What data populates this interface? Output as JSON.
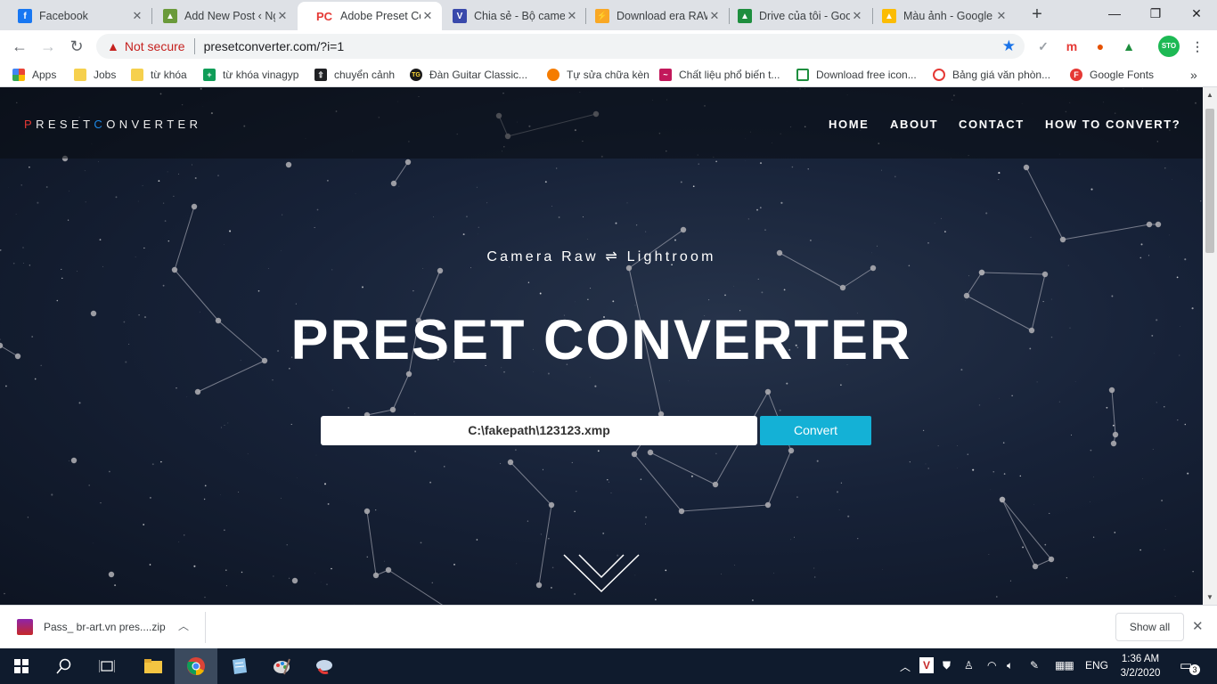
{
  "tabs": [
    {
      "title": "Facebook",
      "favicon_color": "#1877f2",
      "favicon_glyph": "f",
      "active": false
    },
    {
      "title": "Add New Post ‹ Ng",
      "favicon_color": "#6a9a3a",
      "favicon_glyph": "▲",
      "active": false
    },
    {
      "title": "Adobe Preset Conv",
      "favicon_color": "#e53935",
      "favicon_glyph": "PC",
      "active": true
    },
    {
      "title": "Chia sẻ - Bộ came",
      "favicon_color": "#3949ab",
      "favicon_glyph": "V",
      "active": false
    },
    {
      "title": "Download era RAW",
      "favicon_color": "#f9a825",
      "favicon_glyph": "⚡",
      "active": false
    },
    {
      "title": "Drive của tôi - Goo",
      "favicon_color": "#1e8e3e",
      "favicon_glyph": "▲",
      "active": false
    },
    {
      "title": "Màu ảnh - Google",
      "favicon_color": "#fbbc04",
      "favicon_glyph": "▲",
      "active": false
    }
  ],
  "window": {
    "minimize": "—",
    "maximize": "❐",
    "close": "✕",
    "new_tab": "+"
  },
  "omnibox": {
    "security_label": "Not secure",
    "url": "presetconverter.com/?i=1"
  },
  "extensions": {
    "profile": "STO"
  },
  "bookmarks": [
    {
      "label": "Apps",
      "icon": "apps-grid-icon",
      "color": "#4285f4"
    },
    {
      "label": "Jobs",
      "icon": "folder-icon",
      "color": "#f6d04d"
    },
    {
      "label": "từ khóa",
      "icon": "folder-icon",
      "color": "#f6d04d"
    },
    {
      "label": "từ khóa vinagyp",
      "icon": "plus-square-icon",
      "color": "#0f9d58"
    },
    {
      "label": "chuyển cảnh",
      "icon": "cloud-upload-icon",
      "color": "#202124"
    },
    {
      "label": "Đàn Guitar Classic...",
      "icon": "tg-icon",
      "color": "#1a1a1a"
    },
    {
      "label": "Tự sửa chữa kèn",
      "icon": "circle-icon",
      "color": "#f57c00"
    },
    {
      "label": "Chất liệu phổ biến t...",
      "icon": "wave-icon",
      "color": "#c2185b"
    },
    {
      "label": "Download free icon...",
      "icon": "square-icon",
      "color": "#1e8e3e"
    },
    {
      "label": "Bảng giá văn phòn...",
      "icon": "spiral-icon",
      "color": "#e53935"
    },
    {
      "label": "Google Fonts",
      "icon": "f-circle-icon",
      "color": "#e53935"
    }
  ],
  "site": {
    "logo_first": "P",
    "logo_mid": "RESET",
    "logo_c": "C",
    "logo_rest": "ONVERTER",
    "nav": [
      "HOME",
      "ABOUT",
      "CONTACT",
      "HOW TO CONVERT?"
    ],
    "subtitle": "Camera Raw ⇌ Lightroom",
    "title": "PRESET CONVERTER",
    "file_value": "C:\\fakepath\\123123.xmp",
    "convert_label": "Convert",
    "accent_color": "#14b1d6"
  },
  "download": {
    "filename": "Pass_ br-art.vn pres....zip",
    "show_all": "Show all"
  },
  "taskbar": {
    "lang": "ENG",
    "time": "1:36 AM",
    "date": "3/2/2020",
    "notifications": "3"
  }
}
